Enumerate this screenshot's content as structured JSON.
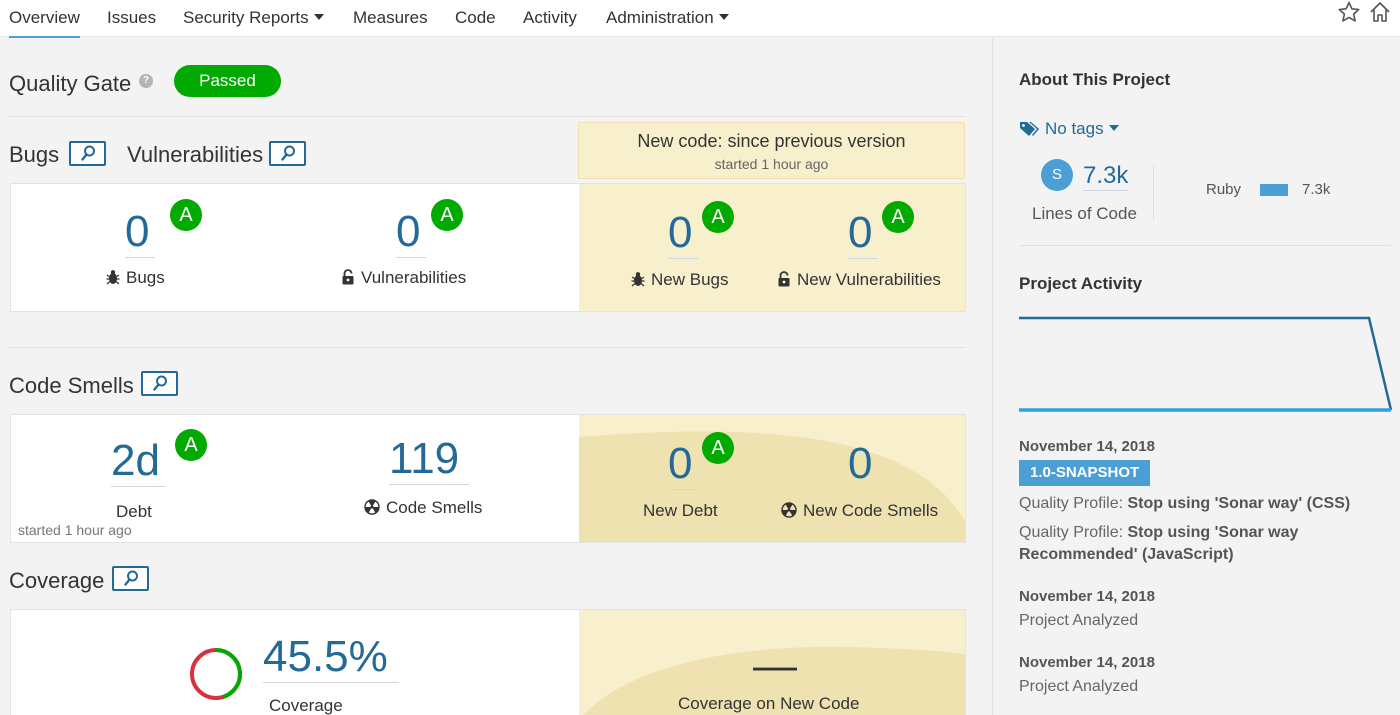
{
  "nav": {
    "tabs": [
      {
        "label": "Overview"
      },
      {
        "label": "Issues"
      },
      {
        "label": "Security Reports"
      },
      {
        "label": "Measures"
      },
      {
        "label": "Code"
      },
      {
        "label": "Activity"
      },
      {
        "label": "Administration"
      }
    ]
  },
  "quality_gate": {
    "title": "Quality Gate",
    "status": "Passed"
  },
  "sections": {
    "bugs": "Bugs",
    "vulnerabilities": "Vulnerabilities",
    "code_smells": "Code Smells",
    "coverage": "Coverage"
  },
  "new_code": {
    "title": "New code: since previous version",
    "started": "started 1 hour ago"
  },
  "reliability": {
    "bugs": {
      "value": "0",
      "grade": "A",
      "label": "Bugs"
    },
    "vulnerabilities": {
      "value": "0",
      "grade": "A",
      "label": "Vulnerabilities"
    },
    "new_bugs": {
      "value": "0",
      "grade": "A",
      "label": "New Bugs"
    },
    "new_vulnerabilities": {
      "value": "0",
      "grade": "A",
      "label": "New Vulnerabilities"
    }
  },
  "maintainability": {
    "debt": {
      "value": "2d",
      "grade": "A",
      "label": "Debt",
      "started": "started 1 hour ago"
    },
    "code_smells": {
      "value": "119",
      "label": "Code Smells"
    },
    "new_debt": {
      "value": "0",
      "grade": "A",
      "label": "New Debt"
    },
    "new_code_smells": {
      "value": "0",
      "label": "New Code Smells"
    }
  },
  "coverage": {
    "value": "45.5%",
    "label": "Coverage",
    "new_value": "—",
    "new_label": "Coverage on New Code"
  },
  "about": {
    "title": "About This Project",
    "tags": "No tags",
    "avatar_letter": "S",
    "loc_value": "7.3k",
    "loc_label": "Lines of Code",
    "language": "Ruby",
    "language_loc": "7.3k"
  },
  "activity": {
    "title": "Project Activity",
    "events": [
      {
        "date": "November 14, 2018",
        "version": "1.0-SNAPSHOT",
        "profiles": [
          {
            "prefix": "Quality Profile: ",
            "text": "Stop using 'Sonar way' (CSS)"
          },
          {
            "prefix": "Quality Profile: ",
            "text": "Stop using 'Sonar way Recommended' (JavaScript)"
          }
        ]
      },
      {
        "date": "November 14, 2018",
        "text": "Project Analyzed"
      },
      {
        "date": "November 14, 2018",
        "text": "Project Analyzed"
      }
    ]
  },
  "colors": {
    "accent": "#236a97",
    "pass": "#00aa00",
    "new_code_bg": "#f8f0cc",
    "badge_blue": "#4b9fd5"
  },
  "icons": [
    "star-icon",
    "home-icon",
    "help-icon",
    "magnifier-icon",
    "bug-icon",
    "lock-icon",
    "code-smell-icon",
    "tag-icon"
  ]
}
